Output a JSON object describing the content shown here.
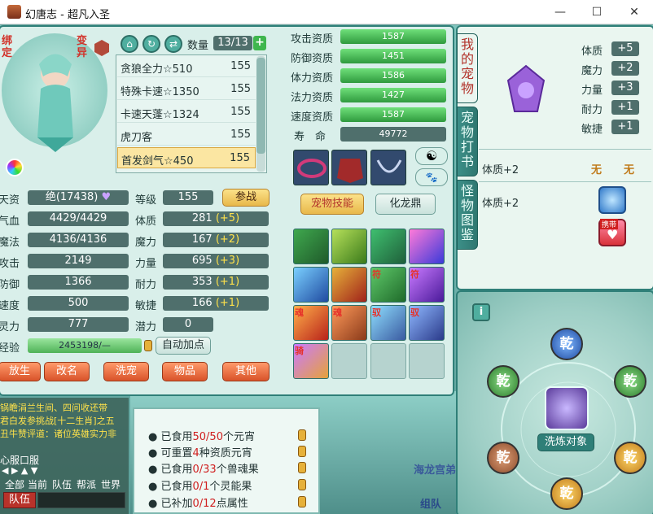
{
  "window": {
    "title": "幻唐志 - 超凡入圣",
    "min": "—",
    "max": "☐",
    "close": "✕"
  },
  "pet": {
    "badge_bind": "绑定",
    "badge_change": "变异",
    "count_label": "数量",
    "count_value": "13/13",
    "list": [
      {
        "name": "贪狼全力☆510",
        "level": "155"
      },
      {
        "name": "特殊卡速☆1350",
        "level": "155"
      },
      {
        "name": "卡速天蓬☆1324",
        "level": "155"
      },
      {
        "name": "虎刀客",
        "level": "155"
      },
      {
        "name": "首发剑气☆450",
        "level": "155"
      }
    ]
  },
  "stats_left": [
    {
      "label": "天资",
      "value": "绝(17438)"
    },
    {
      "label": "气血",
      "value": "4429/4429"
    },
    {
      "label": "魔法",
      "value": "4136/4136"
    },
    {
      "label": "攻击",
      "value": "2149"
    },
    {
      "label": "防御",
      "value": "1366"
    },
    {
      "label": "速度",
      "value": "500"
    },
    {
      "label": "灵力",
      "value": "777"
    }
  ],
  "stats_right": [
    {
      "label": "等级",
      "value": "155",
      "bonus": ""
    },
    {
      "label": "体质",
      "value": "281",
      "bonus": "(+5)"
    },
    {
      "label": "魔力",
      "value": "167",
      "bonus": "(+2)"
    },
    {
      "label": "力量",
      "value": "695",
      "bonus": "(+3)"
    },
    {
      "label": "耐力",
      "value": "353",
      "bonus": "(+1)"
    },
    {
      "label": "敏捷",
      "value": "166",
      "bonus": "(+1)"
    },
    {
      "label": "潜力",
      "value": "0",
      "bonus": ""
    }
  ],
  "battle_button": "参战",
  "exp": {
    "label": "经验",
    "value": "2453198/—",
    "auto_button": "自动加点"
  },
  "bottom_buttons": [
    "放生",
    "改名",
    "洗宠",
    "物品",
    "其他"
  ],
  "aptitudes": [
    {
      "label": "攻击资质",
      "value": "1587"
    },
    {
      "label": "防御资质",
      "value": "1451"
    },
    {
      "label": "体力资质",
      "value": "1586"
    },
    {
      "label": "法力资质",
      "value": "1427"
    },
    {
      "label": "速度资质",
      "value": "1587"
    }
  ],
  "lifespan": {
    "label": "寿　命",
    "value": "49772"
  },
  "skill_tabs": {
    "pet_skill": "宠物技能",
    "dragon": "化龙鼎"
  },
  "skill_tags": [
    "",
    "",
    "",
    "",
    "",
    "",
    "符",
    "符",
    "魂",
    "魂",
    "驭",
    "驭",
    "骑"
  ],
  "side_tabs": [
    "我的宠物",
    "宠物打书",
    "怪物图鉴"
  ],
  "attr_boost": [
    {
      "label": "体质",
      "value": "+5"
    },
    {
      "label": "魔力",
      "value": "+2"
    },
    {
      "label": "力量",
      "value": "+3"
    },
    {
      "label": "耐力",
      "value": "+1"
    },
    {
      "label": "敏捷",
      "value": "+1"
    }
  ],
  "effects": [
    {
      "text": "体质+2",
      "a": "无",
      "b": "无"
    },
    {
      "text": "体质+2",
      "a": "",
      "b": ""
    }
  ],
  "effect_badge": "携带",
  "info_button": "i",
  "wash": {
    "gem_label": "乾",
    "target_label": "洗炼对象"
  },
  "eat_status": [
    {
      "pre": "已食用",
      "red": "50/50",
      "post": "个元宵"
    },
    {
      "pre": "可重置",
      "red": "4",
      "post": "种资质元宵"
    },
    {
      "pre": "已食用",
      "red": "0/33",
      "post": "个兽魂果"
    },
    {
      "pre": "已食用",
      "red": "0/1",
      "post": "个灵能果"
    },
    {
      "pre": "已补加",
      "red": "0/12",
      "post": "点属性"
    }
  ],
  "chat": {
    "lines": [
      "锅瞻涓兰生间、四问收还带",
      "君白发参挑战[十二生肖]之五",
      "丑牛赞评道：诸位英雄实力非",
      "心服口服"
    ],
    "tabs": [
      "全部",
      "当前",
      "队伍",
      "帮派",
      "世界"
    ],
    "team_label": "队伍"
  },
  "scene_text": {
    "palace": "海龙宫弟",
    "group": "组队"
  },
  "colors": {
    "accent": "#2f7f78",
    "gold": "#e8b84a",
    "green": "#3fb64e",
    "red": "#d02020"
  }
}
